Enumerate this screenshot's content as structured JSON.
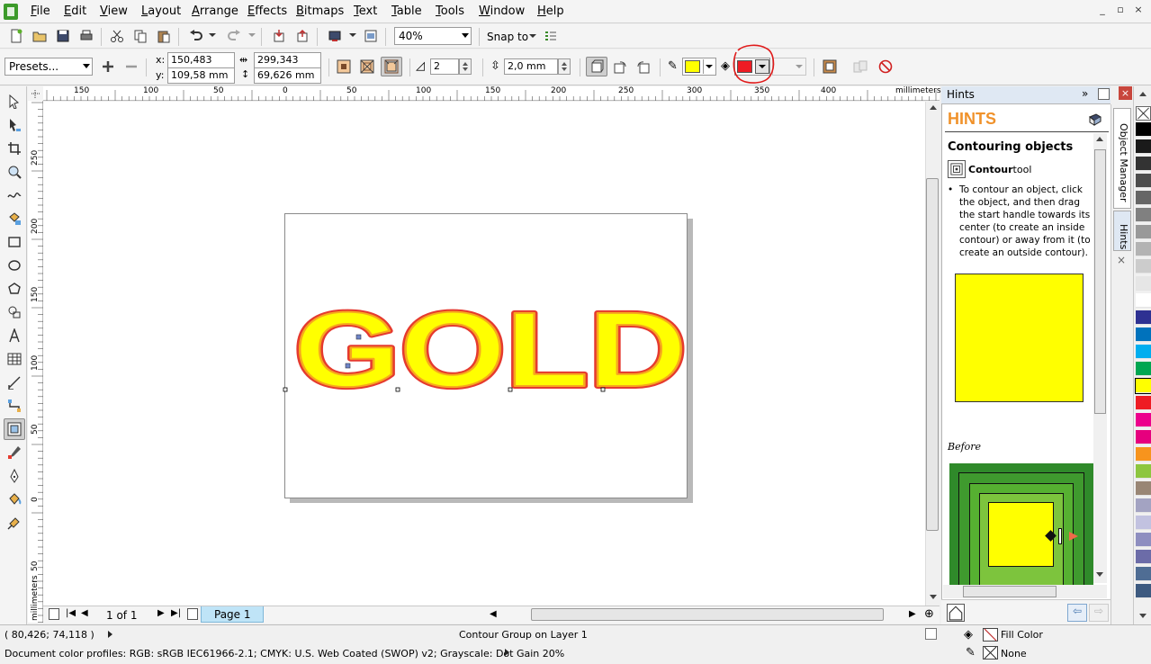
{
  "menu": [
    "File",
    "Edit",
    "View",
    "Layout",
    "Arrange",
    "Effects",
    "Bitmaps",
    "Text",
    "Table",
    "Tools",
    "Window",
    "Help"
  ],
  "window_buttons": [
    "_",
    "▫",
    "×"
  ],
  "standard_toolbar": {
    "zoom_level": "40%",
    "snap_to_label": "Snap to"
  },
  "property_bar": {
    "presets_label": "Presets...",
    "x_value": "150,483 mm",
    "y_value": "109,58 mm",
    "x_label": "x:",
    "y_label": "y:",
    "width_value": "299,343 mm",
    "height_value": "69,626 mm",
    "contour_steps": "2",
    "contour_offset": "2,0 mm",
    "outline_color": "#ffff00",
    "fill_color": "#ee1c24",
    "fill_color_annotated": true
  },
  "ruler": {
    "unit_label": "millimeters",
    "h_ticks": [
      "150",
      "100",
      "50",
      "0",
      "50",
      "100",
      "150",
      "200",
      "250",
      "300",
      "350",
      "400"
    ],
    "v_ticks": [
      "250",
      "200",
      "150",
      "100",
      "50",
      "0",
      "50"
    ]
  },
  "artwork": {
    "text": "GOLD",
    "fill": "#ffff00",
    "outline": "#e53a2f",
    "contour": "#f7a81d"
  },
  "page_nav": {
    "page_count_label": "1 of 1",
    "page_tab": "Page 1"
  },
  "docker": {
    "title": "Hints",
    "heading": "HINTS",
    "topic": "Contouring objects",
    "tool_name": "Contour",
    "tool_suffix": " tool",
    "body": "To contour an object, click the object, and then drag the start handle towards its center (to create an inside contour) or away from it (to create an outside contour).",
    "before_label": "Before",
    "side_tabs": [
      "Object Manager",
      "Hints"
    ]
  },
  "palette": [
    "#ffffff",
    "#000000",
    "#1a1a1a",
    "#333333",
    "#4d4d4d",
    "#666666",
    "#808080",
    "#999999",
    "#b3b3b3",
    "#cccccc",
    "#e6e6e6",
    "#ffffff",
    "#2e3192",
    "#0072bc",
    "#00aeef",
    "#00a651",
    "#ffff00",
    "#ee1c24",
    "#ec008c",
    "#e6007e",
    "#f7941d",
    "#8dc63f",
    "#998675",
    "#a3a3c2",
    "#c2c2e0",
    "#8e8ec0",
    "#6c6ca8",
    "#4f6d94",
    "#3d5a80"
  ],
  "status": {
    "coordinates": "( 80,426; 74,118 )",
    "selection_info": "Contour Group on Layer 1",
    "color_profiles": "Document color profiles: RGB: sRGB IEC61966-2.1; CMYK: U.S. Web Coated (SWOP) v2; Grayscale: Dot Gain 20%",
    "fill_label": "Fill Color",
    "outline_label": "None"
  }
}
